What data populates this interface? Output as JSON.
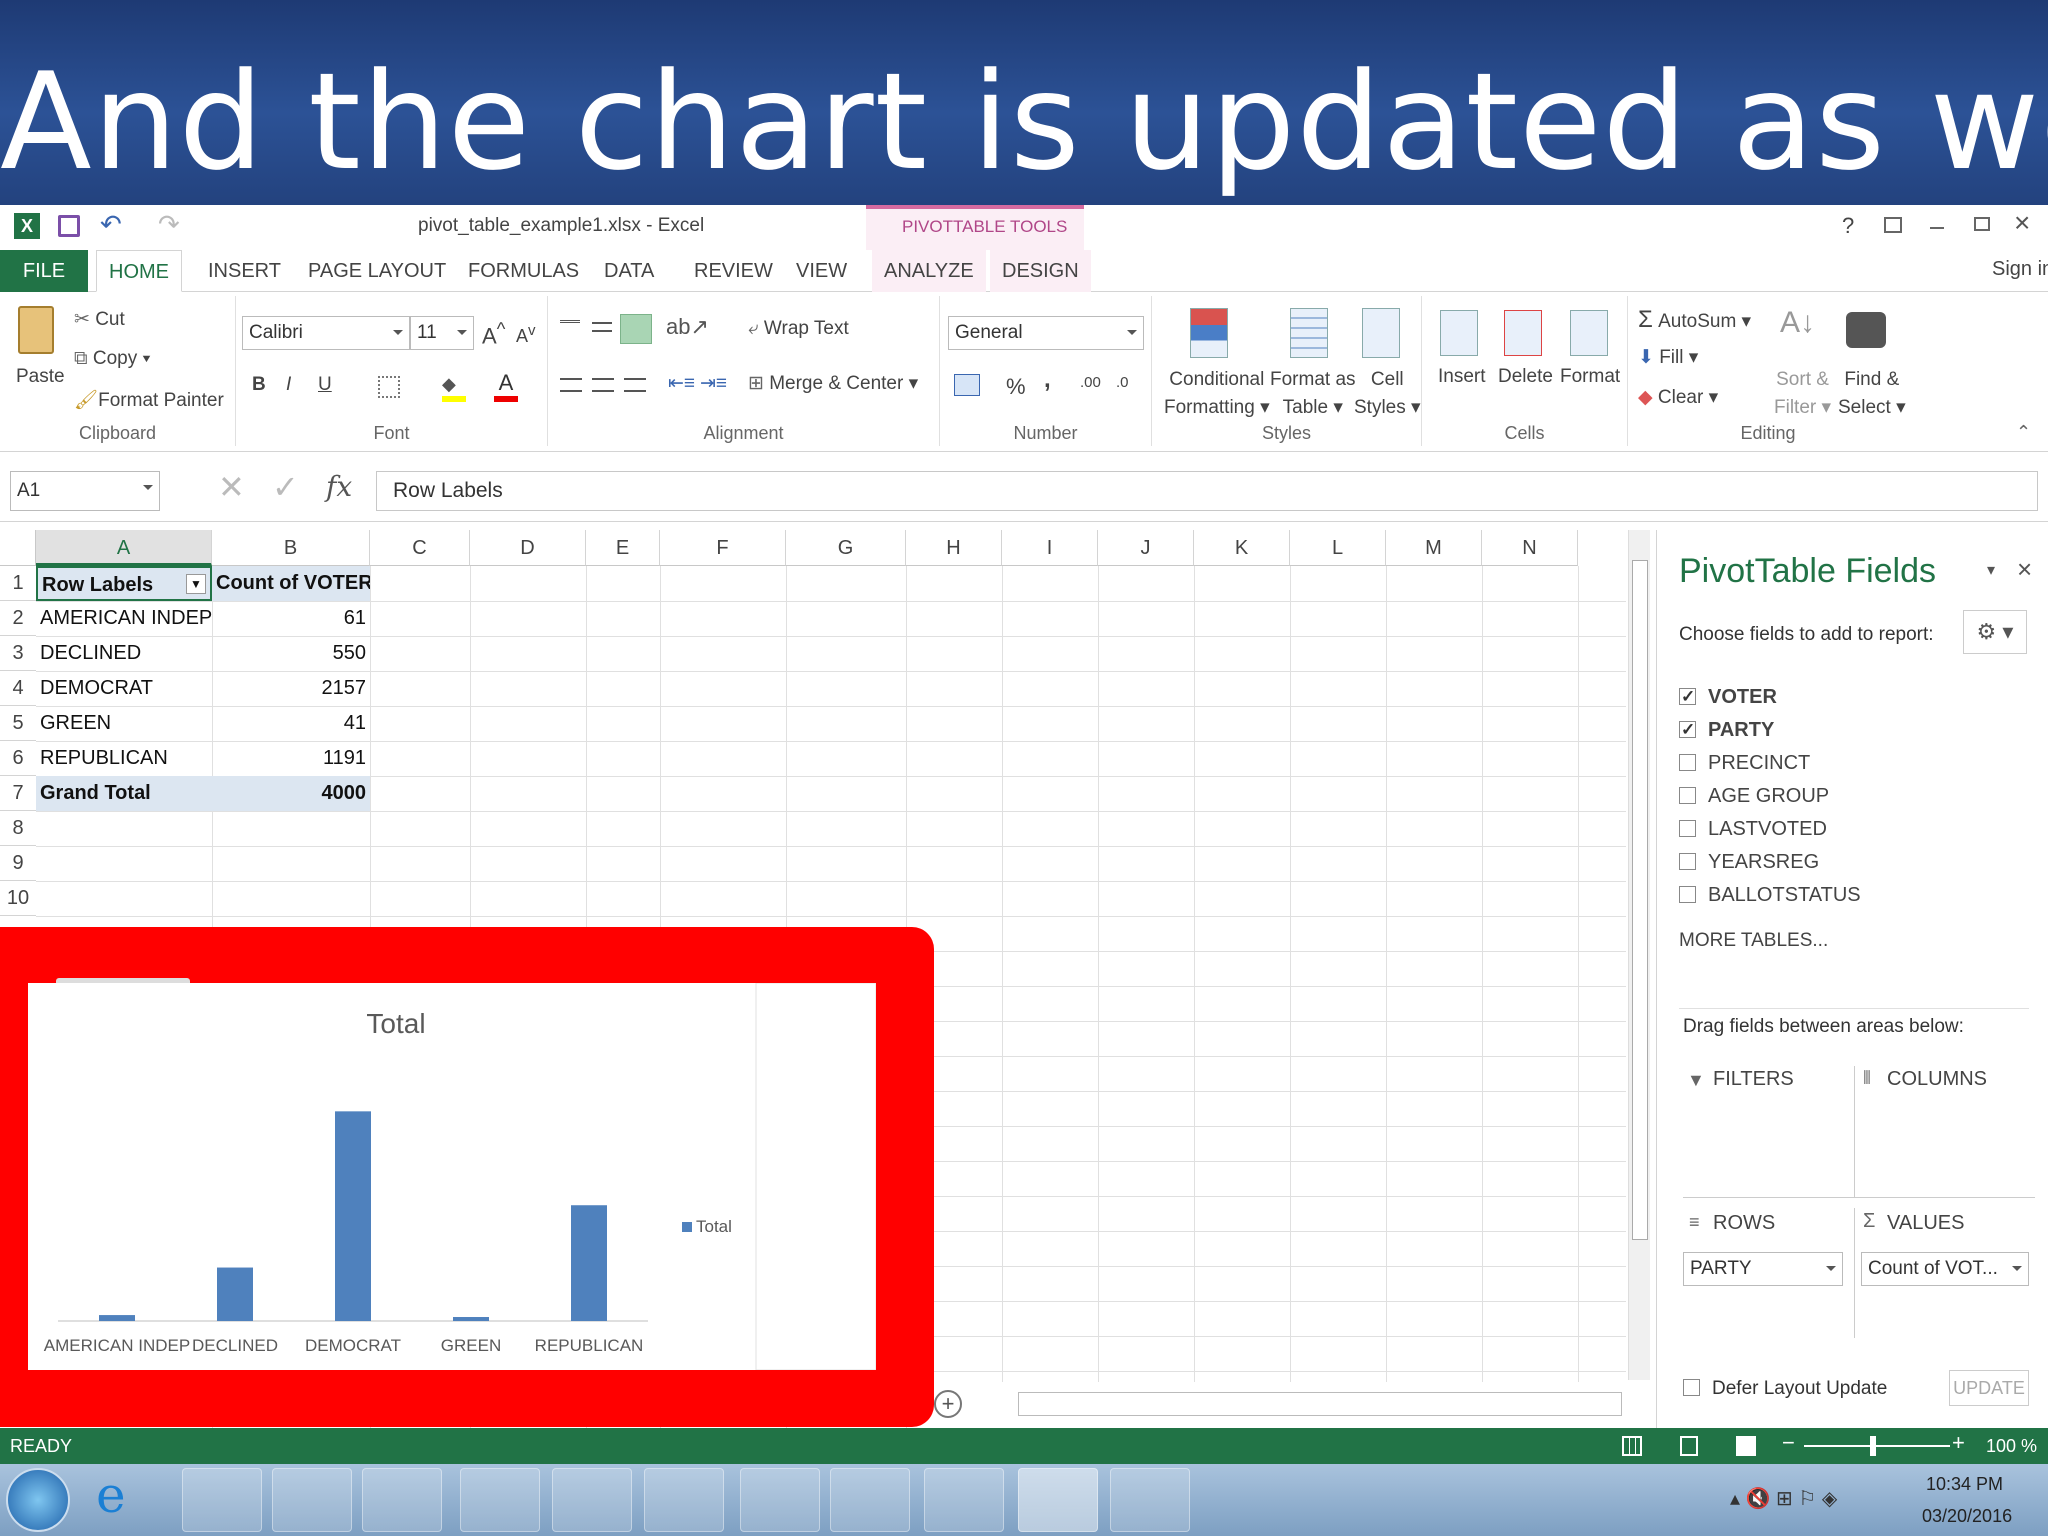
{
  "banner": {
    "title": "And the chart is updated as well"
  },
  "window": {
    "title": "pivot_table_example1.xlsx - Excel",
    "context_tab": "PIVOTTABLE TOOLS",
    "sign_in": "Sign in",
    "help": "?"
  },
  "tabs": [
    "FILE",
    "HOME",
    "INSERT",
    "PAGE LAYOUT",
    "FORMULAS",
    "DATA",
    "REVIEW",
    "VIEW",
    "ANALYZE",
    "DESIGN"
  ],
  "ribbon": {
    "clipboard": {
      "paste": "Paste",
      "cut": "Cut",
      "copy": "Copy",
      "format_painter": "Format Painter",
      "label": "Clipboard"
    },
    "font": {
      "name": "Calibri",
      "size": "11",
      "bold": "B",
      "italic": "I",
      "underline": "U",
      "label": "Font"
    },
    "alignment": {
      "wrap": "Wrap Text",
      "merge": "Merge & Center",
      "label": "Alignment"
    },
    "number": {
      "format": "General",
      "percent": "%",
      "comma": ",",
      "label": "Number"
    },
    "styles": {
      "conditional": [
        "Conditional",
        "Formatting"
      ],
      "format_table": [
        "Format as",
        "Table"
      ],
      "cell_styles": [
        "Cell",
        "Styles"
      ],
      "label": "Styles"
    },
    "cells": {
      "insert": "Insert",
      "delete": "Delete",
      "format": "Format",
      "label": "Cells"
    },
    "editing": {
      "autosum": "AutoSum",
      "fill": "Fill",
      "clear": "Clear",
      "sort": [
        "Sort &",
        "Filter"
      ],
      "find": [
        "Find &",
        "Select"
      ],
      "label": "Editing"
    }
  },
  "formula": {
    "name_box": "A1",
    "fx": "fx",
    "value": "Row Labels"
  },
  "columns": [
    "A",
    "B",
    "C",
    "D",
    "E",
    "F",
    "G",
    "H",
    "I",
    "J",
    "K",
    "L",
    "M",
    "N"
  ],
  "rows": [
    "1",
    "2",
    "3",
    "4",
    "5",
    "6",
    "7",
    "8",
    "9",
    "10"
  ],
  "pivot": {
    "header": [
      "Row Labels",
      "Count of VOTER"
    ],
    "data": [
      [
        "AMERICAN INDEP",
        "61"
      ],
      [
        "DECLINED",
        "550"
      ],
      [
        "DEMOCRAT",
        "2157"
      ],
      [
        "GREEN",
        "41"
      ],
      [
        "REPUBLICAN",
        "1191"
      ]
    ],
    "total": [
      "Grand Total",
      "4000"
    ]
  },
  "chart_data": {
    "type": "bar",
    "title": "Total",
    "categories": [
      "AMERICAN INDEP",
      "DECLINED",
      "DEMOCRAT",
      "GREEN",
      "REPUBLICAN"
    ],
    "series": [
      {
        "name": "Total",
        "values": [
          61,
          550,
          2157,
          41,
          1191
        ]
      }
    ],
    "ylim": [
      0,
      2500
    ],
    "legend": "right",
    "color": "#4f81bd"
  },
  "fields_pane": {
    "title": "PivotTable Fields",
    "subtitle": "Choose fields to add to report:",
    "fields": [
      {
        "name": "VOTER",
        "checked": true
      },
      {
        "name": "PARTY",
        "checked": true
      },
      {
        "name": "PRECINCT",
        "checked": false
      },
      {
        "name": "AGE GROUP",
        "checked": false
      },
      {
        "name": "LASTVOTED",
        "checked": false
      },
      {
        "name": "YEARSREG",
        "checked": false
      },
      {
        "name": "BALLOTSTATUS",
        "checked": false
      }
    ],
    "more": "MORE TABLES...",
    "drag_hint": "Drag fields between areas below:",
    "filters": "FILTERS",
    "columns": "COLUMNS",
    "rows": "ROWS",
    "values": "VALUES",
    "rows_item": "PARTY",
    "values_item": "Count of VOT...",
    "defer": "Defer Layout Update",
    "update": "UPDATE"
  },
  "status": {
    "ready": "READY",
    "zoom": "100 %"
  },
  "taskbar": {
    "time": "10:34 PM",
    "date": "03/20/2016"
  }
}
